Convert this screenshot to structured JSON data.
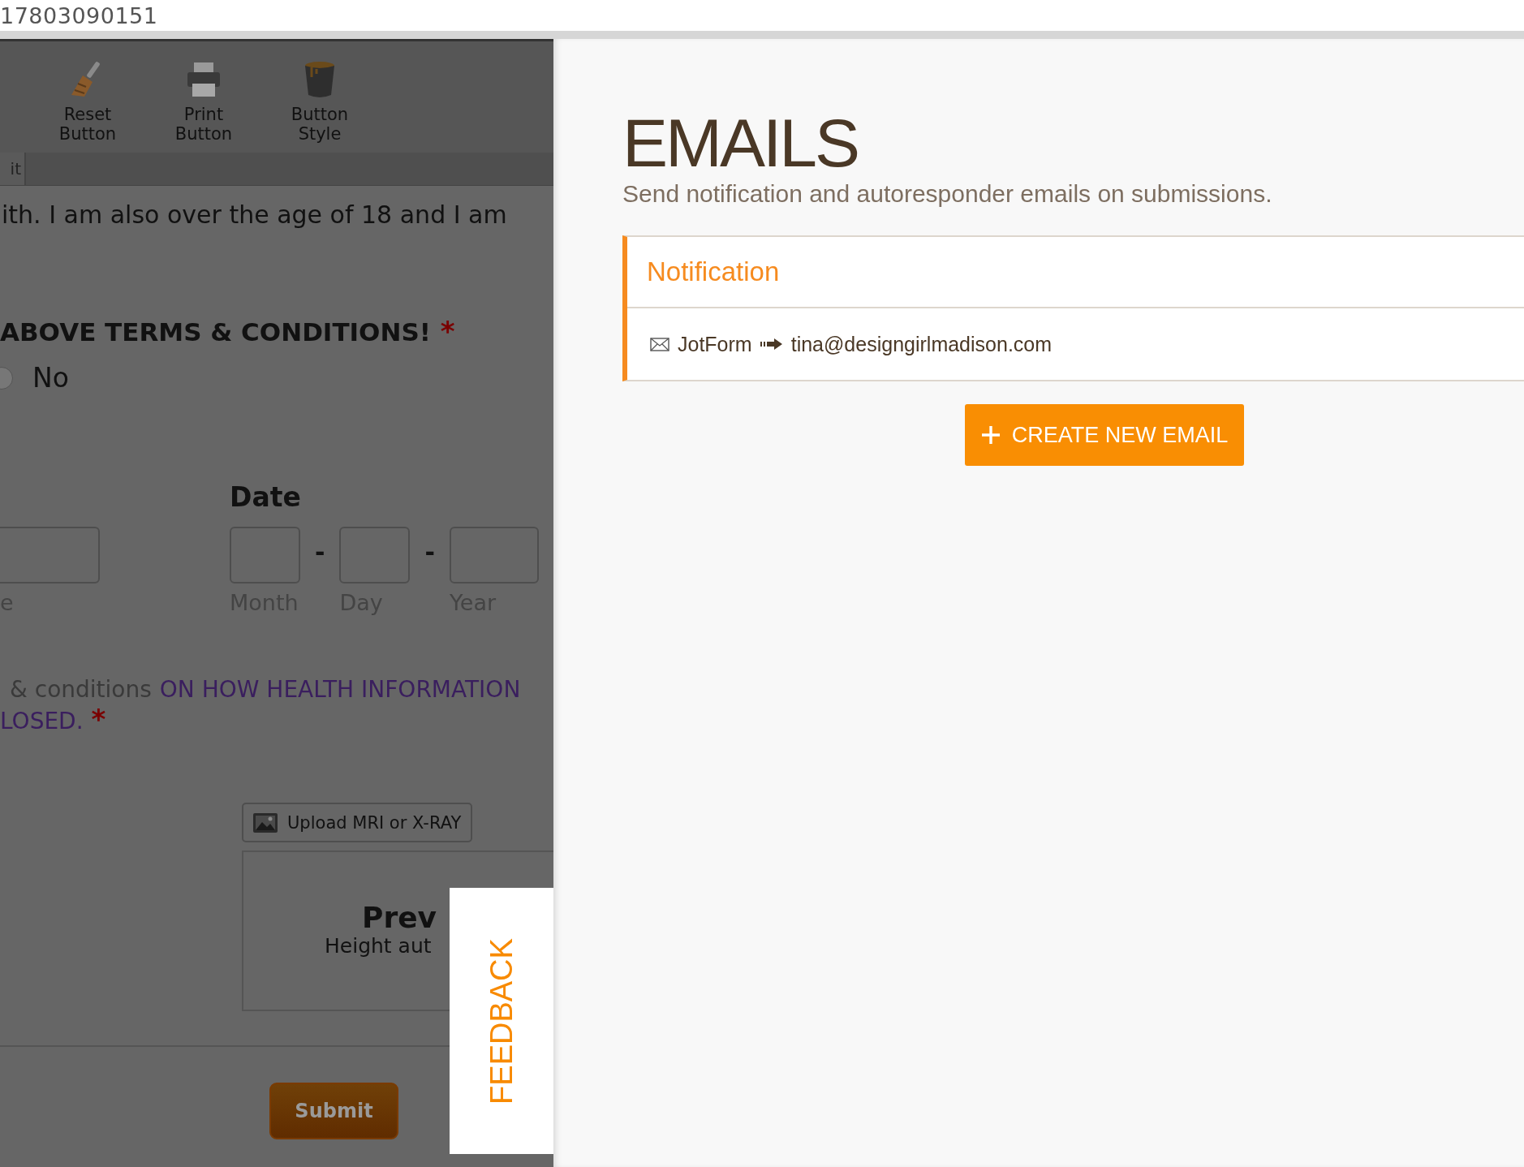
{
  "address_bar": {
    "text": "17803090151"
  },
  "form_preview": {
    "toolbar": [
      {
        "label": "Reset Button",
        "kind": "broom"
      },
      {
        "label": "Print Button",
        "kind": "printer"
      },
      {
        "label": "Button Style",
        "kind": "paint"
      }
    ],
    "tab": "it",
    "consent_text": "ith. I am also over the age of 18 and I am",
    "terms_heading": "ABOVE TERMS & CONDITIONS!",
    "terms_required": "*",
    "radio": {
      "label": "No",
      "selected": false
    },
    "name_sublabel": "e",
    "date": {
      "label": "Date",
      "separators": [
        "-",
        "-"
      ],
      "fields": [
        {
          "sublabel": "Month"
        },
        {
          "sublabel": "Day"
        },
        {
          "sublabel": "Year"
        }
      ]
    },
    "health": {
      "plain": "& conditions",
      "link": "ON HOW HEALTH INFORMATION",
      "line_2": "LOSED.",
      "required": "*"
    },
    "upload_button": "Upload MRI or X-RAY",
    "preview": {
      "title": "Prev",
      "subtitle": "Height aut"
    },
    "submit_button": "Submit"
  },
  "feedback_tab": "FEEDBACK",
  "emails": {
    "title": "EMAILS",
    "subtitle": "Send notification and autoresponder emails on submissions.",
    "cards": [
      {
        "title": "Notification",
        "from": "JotForm",
        "to": "tina@designgirlmadison.com"
      }
    ],
    "create_button": "CREATE NEW EMAIL"
  }
}
